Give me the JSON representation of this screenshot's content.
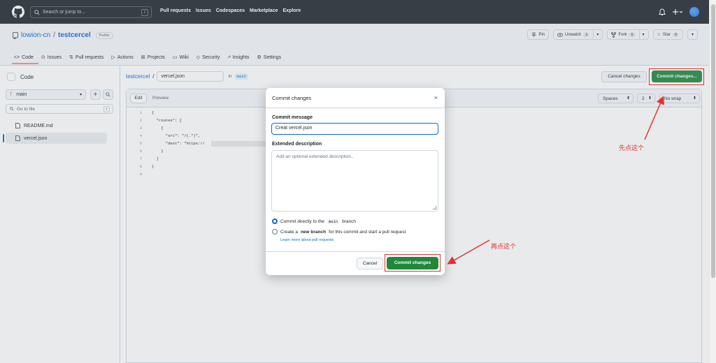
{
  "header": {
    "search_placeholder": "Search or jump to...",
    "search_key": "/",
    "nav": [
      "Pull requests",
      "Issues",
      "Codespaces",
      "Marketplace",
      "Explore"
    ],
    "bell_icon": "bell-icon",
    "plus_icon": "plus-icon"
  },
  "repo": {
    "owner": "lowion-cn",
    "slash": "/",
    "name": "testcercel",
    "visibility": "Public",
    "pin_label": "Pin",
    "watch_label": "Unwatch",
    "watch_count": "1",
    "fork_label": "Fork",
    "fork_count": "0",
    "star_label": "Star",
    "star_count": "0",
    "tabs": [
      "Code",
      "Issues",
      "Pull requests",
      "Actions",
      "Projects",
      "Wiki",
      "Security",
      "Insights",
      "Settings"
    ]
  },
  "tree": {
    "title": "Code",
    "branch": "main",
    "add_label": "+",
    "goto_placeholder": "Go to file",
    "goto_key": "t",
    "files": [
      "README.md",
      "vercel.json"
    ]
  },
  "editor": {
    "path_repo": "testcercel",
    "path_sep": "/",
    "filename": "vercel.json",
    "in_label": "in",
    "branch_chip": "main",
    "cancel_label": "Cancel changes",
    "commit_label": "Commit changes...",
    "edit_tab": "Edit",
    "preview_tab": "Preview",
    "indent_mode": "Spaces",
    "indent_size": "2",
    "wrap_mode": "No wrap",
    "lines": [
      {
        "n": "1",
        "t": "{"
      },
      {
        "n": "2",
        "t": "  \"routes\": ["
      },
      {
        "n": "3",
        "t": "    {"
      },
      {
        "n": "4",
        "t": "      \"src\": \"/(.*)\","
      },
      {
        "n": "5",
        "t": "      \"dest\": \"https://"
      },
      {
        "n": "6",
        "t": "    }"
      },
      {
        "n": "7",
        "t": "  ]"
      },
      {
        "n": "8",
        "t": "}"
      },
      {
        "n": "9",
        "t": ""
      }
    ]
  },
  "modal": {
    "title": "Commit changes",
    "close": "×",
    "message_label": "Commit message",
    "message_value": "Creat vercel.json",
    "desc_label": "Extended description",
    "desc_placeholder": "Add an optional extended description..",
    "option_direct_pre": "Commit directly to the",
    "option_direct_branch": "main",
    "option_direct_post": "branch",
    "option_new_pre": "Create a",
    "option_new_bold": "new branch",
    "option_new_post": "for this commit and start a pull request",
    "learn_more": "Learn more about pull requests",
    "cancel_label": "Cancel",
    "commit_label": "Commit changes"
  },
  "annotations": {
    "first": "先点这个",
    "second": "再点这个",
    "color": "#e3322e"
  },
  "colors": {
    "primary_green": "#1f883d",
    "link_blue": "#0969da",
    "header_bg": "#24292f"
  }
}
